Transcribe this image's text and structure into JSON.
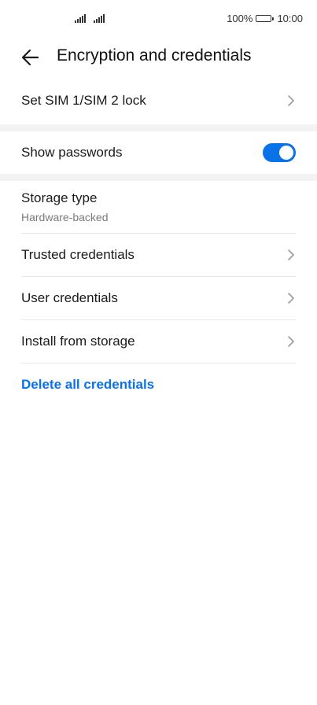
{
  "status_bar": {
    "battery_percent": "100%",
    "time": "10:00"
  },
  "header": {
    "title": "Encryption and credentials"
  },
  "items": {
    "sim_lock": "Set SIM 1/SIM 2 lock",
    "show_passwords": "Show passwords",
    "show_passwords_enabled": true,
    "storage_type": {
      "title": "Storage type",
      "value": "Hardware-backed"
    },
    "trusted_credentials": "Trusted credentials",
    "user_credentials": "User credentials",
    "install_from_storage": "Install from storage",
    "delete_all_credentials": "Delete all credentials"
  },
  "colors": {
    "accent": "#0a72e8",
    "section_gap": "#f3f3f3",
    "divider": "#e8e8e8"
  }
}
